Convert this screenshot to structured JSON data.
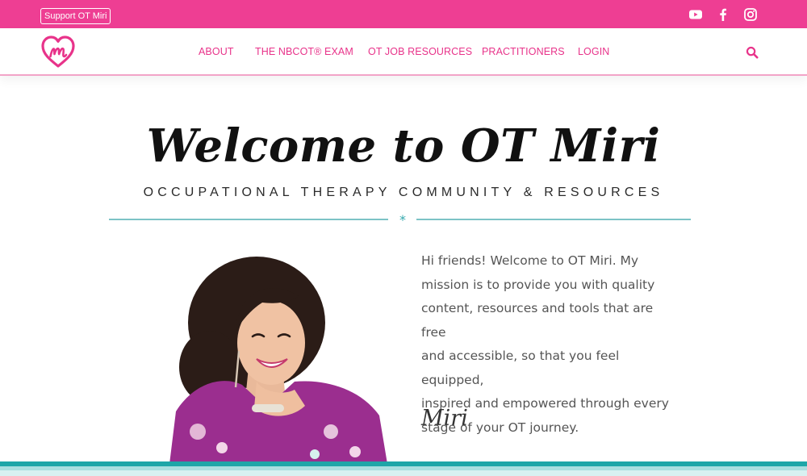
{
  "topbar": {
    "support_label": "Support OT Miri",
    "icons": [
      "youtube-icon",
      "facebook-icon",
      "instagram-icon"
    ]
  },
  "nav": {
    "logo_icon": "heart-m-logo-icon",
    "items": [
      "ABOUT",
      "THE NBCOT® EXAM",
      "OT JOB RESOURCES",
      "PRACTITIONERS",
      "LOGIN"
    ],
    "search_icon": "search-icon"
  },
  "hero": {
    "title": "Welcome to OT Miri",
    "subtitle": "OCCUPATIONAL THERAPY COMMUNITY & RESOURCES",
    "divider_glyph": "*"
  },
  "intro": {
    "lines": [
      "Hi friends! Welcome to OT Miri. My",
      "mission is to provide you with quality",
      "content, resources and tools that are free",
      "and accessible, so that you feel equipped,",
      "inspired and empowered through every",
      "stage of your OT journey."
    ],
    "signature": "Miri"
  },
  "colors": {
    "brand_pink": "#ee3e93",
    "nav_pink": "#e8338a",
    "teal": "#36a9ae",
    "teal_light": "#cfeeee"
  }
}
